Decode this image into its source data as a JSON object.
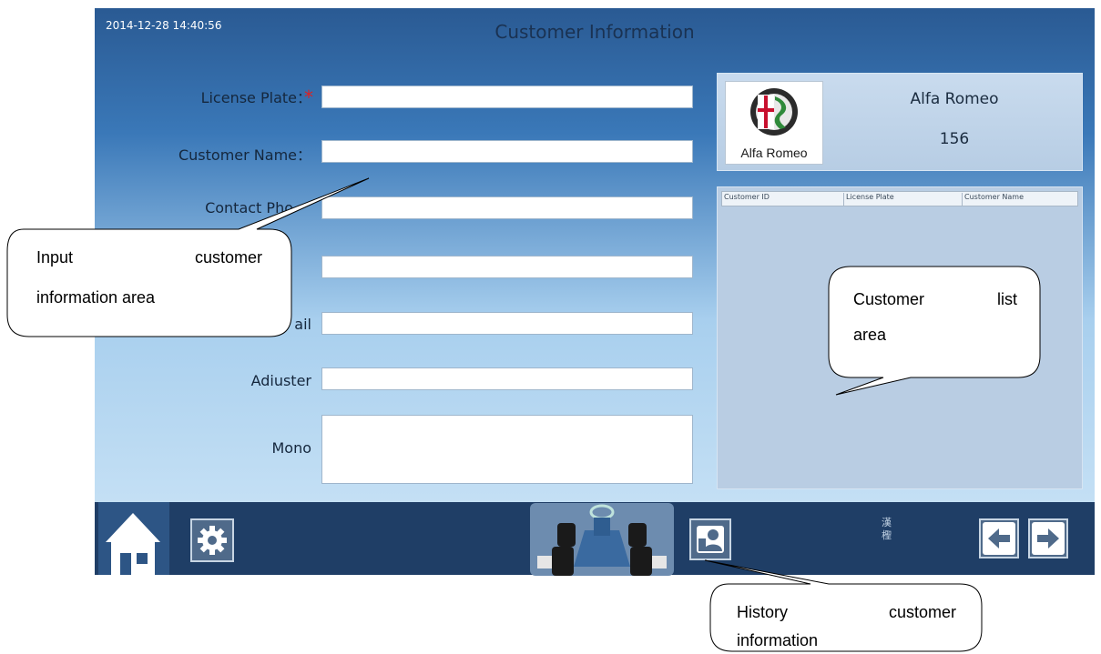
{
  "header": {
    "timestamp": "2014-12-28 14:40:56",
    "title": "Customer Information"
  },
  "form": {
    "license_plate_label": "License Plate：",
    "required_mark": "*",
    "customer_name_label": "Customer Name：",
    "contact_phone_label": "Contact Pho",
    "email_label_suffix": "ail",
    "adjuster_label": "Adiuster",
    "mono_label": "Mono",
    "fields": {
      "license_plate": "",
      "customer_name": "",
      "contact_phone": "",
      "address": "",
      "email": "",
      "adjuster": "",
      "mono": ""
    }
  },
  "vehicle": {
    "brand": "Alfa Romeo",
    "model": "156",
    "logo_text": "Alfa Romeo",
    "logo_icon": "alfa-romeo-badge-icon"
  },
  "customer_list": {
    "columns": [
      "Customer ID",
      "License Plate",
      "Customer Name"
    ],
    "rows": []
  },
  "toolbar": {
    "home_icon": "home-icon",
    "settings_icon": "gear-icon",
    "vehicle_icon": "car-icon",
    "history_icon": "user-history-icon",
    "small_chars": [
      "漢",
      "檉"
    ],
    "back_icon": "arrow-left-icon",
    "forward_icon": "arrow-right-icon"
  },
  "callouts": {
    "input_area_line1": "Input customer",
    "input_area_line2": "information area",
    "list_area_line1": "Customer list",
    "list_area_line2": "area",
    "history_line1": "History customer",
    "history_line2": "information"
  },
  "colors": {
    "header_blue": "#2a5a93",
    "bottom_bar": "#1f3e66",
    "required": "#e02020"
  }
}
